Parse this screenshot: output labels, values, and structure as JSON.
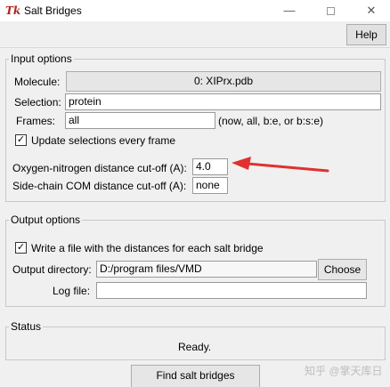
{
  "window": {
    "title": "Salt Bridges",
    "icon": "Tk",
    "minimize_glyph": "—",
    "close_glyph": "✕"
  },
  "menu": {
    "help_label": "Help"
  },
  "input_options": {
    "group_label": "Input options",
    "molecule_label": "Molecule:",
    "molecule_value": "0: XIPrx.pdb",
    "selection_label": "Selection:",
    "selection_value": "protein",
    "frames_label": "Frames:",
    "frames_value": "all",
    "frames_hint": "(now, all, b:e, or b:s:e)",
    "update_label": "Update selections every frame",
    "update_checked": "✓",
    "on_cutoff_label": "Oxygen-nitrogen distance cut-off (A):",
    "on_cutoff_value": "4.0",
    "com_cutoff_label": "Side-chain COM distance cut-off (A):",
    "com_cutoff_value": "none"
  },
  "output_options": {
    "group_label": "Output options",
    "write_label": "Write a file with the distances for each salt bridge",
    "write_checked": "✓",
    "dir_label": "Output directory:",
    "dir_value": "D:/program files/VMD",
    "choose_label": "Choose",
    "log_label": "Log file:",
    "log_value": ""
  },
  "status": {
    "group_label": "Status",
    "text": "Ready."
  },
  "actions": {
    "find_label": "Find salt bridges"
  },
  "annotation": {
    "arrow_color": "#e03030"
  },
  "watermark": {
    "text": "知乎 @掌天库日"
  }
}
